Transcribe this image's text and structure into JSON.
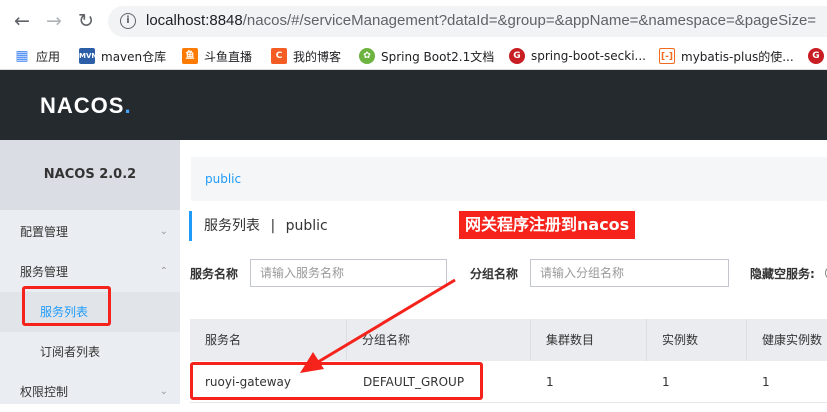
{
  "browser": {
    "back_icon": "arrow-left-icon",
    "forward_icon": "arrow-right-icon",
    "reload_icon": "reload-icon",
    "url_host": "localhost:8848",
    "url_path": "/nacos/#/serviceManagement?dataId=&group=&appName=&namespace=&pageSize="
  },
  "bookmarks": [
    {
      "label": "应用",
      "icon": "apps-grid-icon",
      "color": "#4285f4"
    },
    {
      "label": "maven仓库",
      "icon": "mvn-icon",
      "color": "#2c5ea8"
    },
    {
      "label": "斗鱼直播",
      "icon": "douyu-icon",
      "color": "#ff7a00"
    },
    {
      "label": "我的博客",
      "icon": "csdn-icon",
      "color": "#f55c23"
    },
    {
      "label": "Spring Boot2.1文档",
      "icon": "spring-icon",
      "color": "#6db33f"
    },
    {
      "label": "spring-boot-secki...",
      "icon": "gitee-icon",
      "color": "#c71d23"
    },
    {
      "label": "mybatis-plus的使...",
      "icon": "bracket-icon",
      "color": "#f06a1f"
    },
    {
      "label": "",
      "icon": "gitee-icon",
      "color": "#c71d23"
    }
  ],
  "header": {
    "logo_text": "NACOS",
    "logo_dot": "."
  },
  "sidebar": {
    "version": "NACOS 2.0.2",
    "items": [
      {
        "label": "配置管理"
      },
      {
        "label": "服务管理"
      },
      {
        "label": "服务列表"
      },
      {
        "label": "订阅者列表"
      },
      {
        "label": "权限控制"
      }
    ]
  },
  "main": {
    "breadcrumb": "public",
    "title": "服务列表",
    "title_sep": "|",
    "title_ns": "public",
    "filters": {
      "service_label": "服务名称",
      "service_placeholder": "请输入服务名称",
      "group_label": "分组名称",
      "group_placeholder": "请输入分组名称",
      "hide_empty_label": "隐藏空服务:"
    },
    "table": {
      "headers": [
        "服务名",
        "分组名称",
        "集群数目",
        "实例数",
        "健康实例数"
      ],
      "rows": [
        [
          "ruoyi-gateway",
          "DEFAULT_GROUP",
          "1",
          "1",
          "1"
        ]
      ]
    }
  },
  "annotation": {
    "note": "网关程序注册到nacos",
    "color": "#f5231b"
  }
}
